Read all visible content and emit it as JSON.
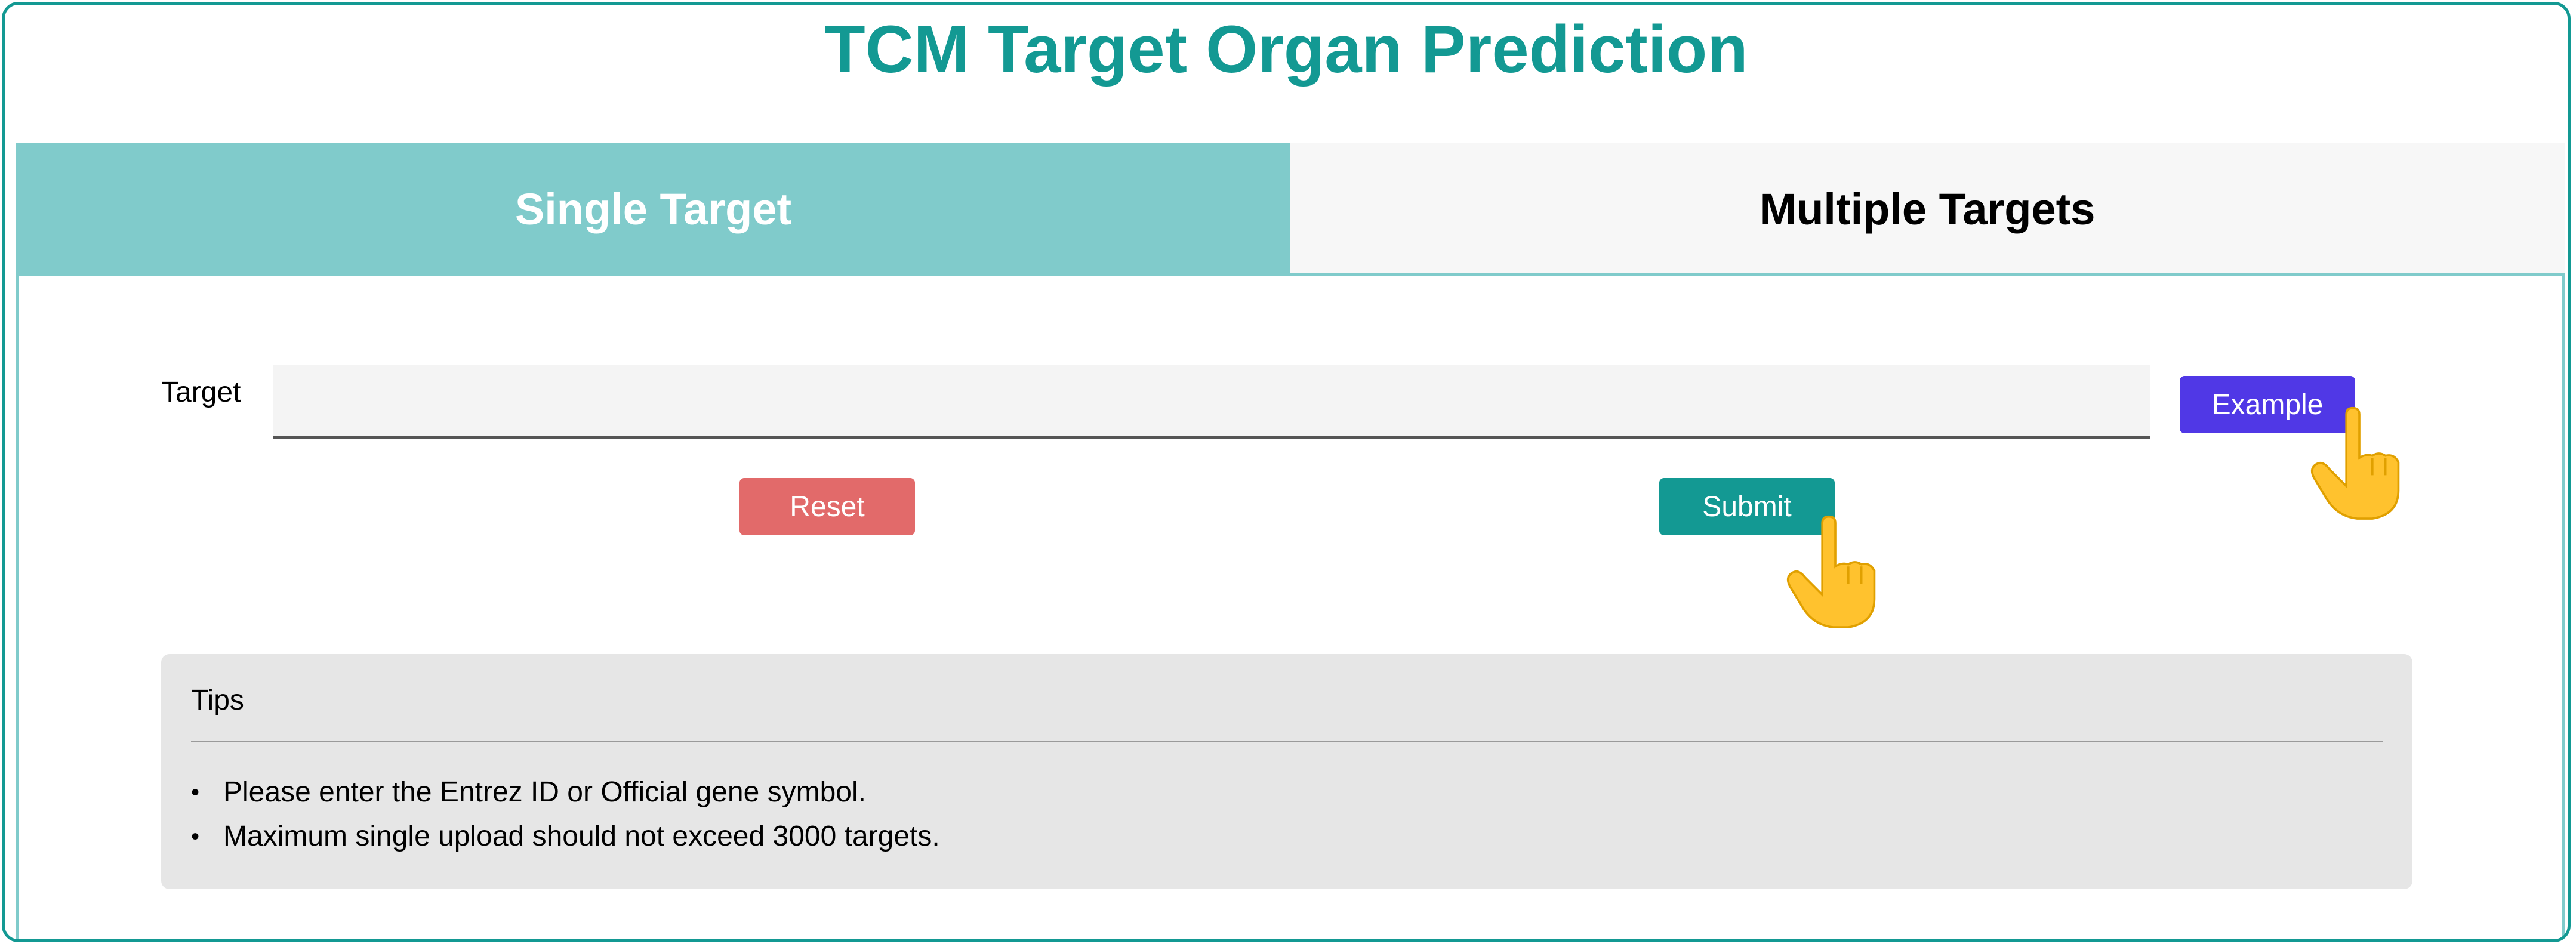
{
  "page": {
    "title": "TCM Target Organ Prediction",
    "colors": {
      "accent": "#139993",
      "tab_active": "#80cbcb",
      "tab_inactive": "#f7f7f7",
      "example_button": "#5038e6",
      "reset_button": "#e26a6a",
      "submit_button": "#139993",
      "tips_background": "#e6e6e6"
    }
  },
  "tabs": [
    {
      "label": "Single Target",
      "active": true
    },
    {
      "label": "Multiple Targets",
      "active": false
    }
  ],
  "form": {
    "target_label": "Target",
    "target_value": "",
    "target_placeholder": "",
    "example_label": "Example",
    "reset_label": "Reset",
    "submit_label": "Submit"
  },
  "tips": {
    "title": "Tips",
    "items": [
      {
        "bullet": "•",
        "text": "Please enter the Entrez ID or Official gene symbol."
      },
      {
        "bullet": "•",
        "text": "Maximum single upload should not exceed 3000 targets."
      }
    ]
  },
  "icons": {
    "pointer": "pointing-hand-icon"
  }
}
